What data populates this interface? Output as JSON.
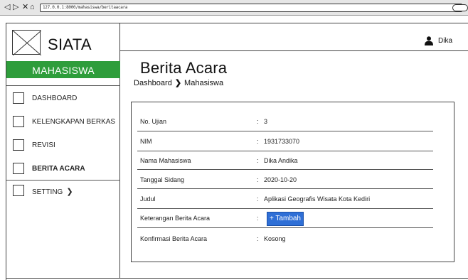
{
  "browser": {
    "back_glyph": "◁",
    "forward_glyph": "▷",
    "close_glyph": "✕",
    "home_glyph": "⌂",
    "url": "127.0.0.1:8000/mahasiswa/beritaacara"
  },
  "app": {
    "title": "SIATA",
    "role": "MAHASISWA",
    "accent_color": "#2e9d3b",
    "button_color": "#2f6fd6"
  },
  "sidebar": {
    "items": [
      {
        "label": "DASHBOARD",
        "active": false
      },
      {
        "label": "KELENGKAPAN BERKAS",
        "active": false
      },
      {
        "label": "REVISI",
        "active": false
      },
      {
        "label": "BERITA ACARA",
        "active": true
      },
      {
        "label": "SETTING",
        "active": false,
        "chevron": "❯"
      }
    ]
  },
  "header": {
    "user_icon": "user-icon",
    "user_name": "Dika"
  },
  "page": {
    "title": "Berita Acara",
    "breadcrumb": {
      "parent": "Dashboard",
      "separator": "❯",
      "current": "Mahasiswa"
    }
  },
  "details": {
    "colon": ":",
    "rows": [
      {
        "label": "No. Ujian",
        "value": "3"
      },
      {
        "label": "NIM",
        "value": "1931733070"
      },
      {
        "label": "Nama Mahasiswa",
        "value": "Dika Andika"
      },
      {
        "label": "Tanggal Sidang",
        "value": "2020-10-20"
      },
      {
        "label": "Judul",
        "value": "Aplikasi Geografis Wisata Kota Kediri"
      },
      {
        "label": "Keterangan Berita Acara",
        "value": ""
      },
      {
        "label": "Konfirmasi Berita Acara",
        "value": "Kosong"
      }
    ],
    "add_button_label": "+ Tambah"
  }
}
